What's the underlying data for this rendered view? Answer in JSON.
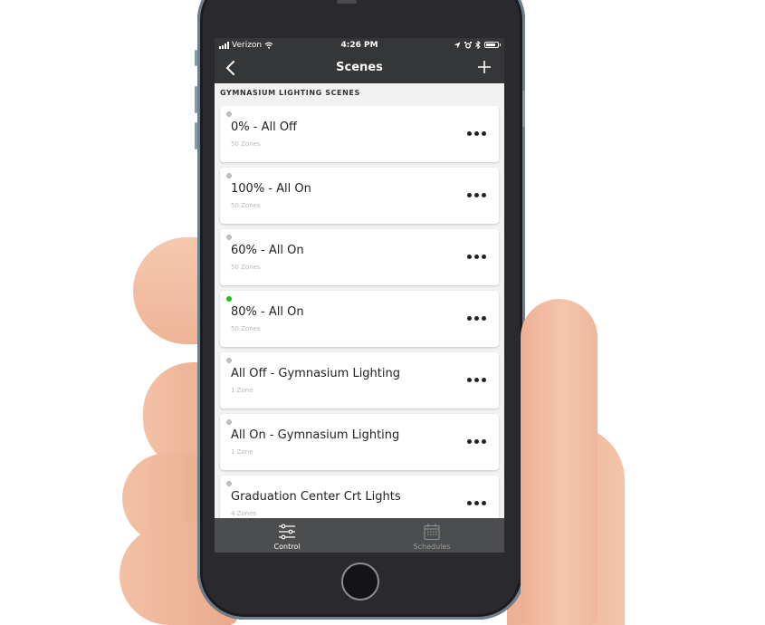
{
  "status_bar": {
    "carrier": "Verizon",
    "time": "4:26 PM",
    "icons": [
      "signal-icon",
      "wifi-icon",
      "location-icon",
      "alarm-icon",
      "bluetooth-icon",
      "battery-icon"
    ]
  },
  "nav": {
    "title": "Scenes",
    "back_icon": "chevron-left-icon",
    "add_icon": "plus-icon"
  },
  "section": {
    "title": "GYMNASIUM LIGHTING SCENES"
  },
  "scenes": [
    {
      "name": "0% - All Off",
      "zones": "50 Zones",
      "active": false
    },
    {
      "name": "100% - All On",
      "zones": "50 Zones",
      "active": false
    },
    {
      "name": "60% - All On",
      "zones": "50 Zones",
      "active": false
    },
    {
      "name": "80% - All On",
      "zones": "50 Zones",
      "active": true
    },
    {
      "name": "All Off - Gymnasium Lighting",
      "zones": "1 Zone",
      "active": false
    },
    {
      "name": "All On - Gymnasium Lighting",
      "zones": "1 Zone",
      "active": false
    },
    {
      "name": "Graduation Center Crt Lights",
      "zones": "4 Zones",
      "active": false
    }
  ],
  "tabs": [
    {
      "label": "Control",
      "icon": "sliders-icon",
      "selected": true
    },
    {
      "label": "Schedules",
      "icon": "calendar-icon",
      "selected": false
    }
  ],
  "colors": {
    "active_dot": "#16c313",
    "inactive_dot": "#bdbdbd",
    "bar_bg": "#353637",
    "tabbar_bg": "#4c4d4e",
    "tab_selected": "#ffffff",
    "tab_unselected": "#9a9b9c"
  }
}
